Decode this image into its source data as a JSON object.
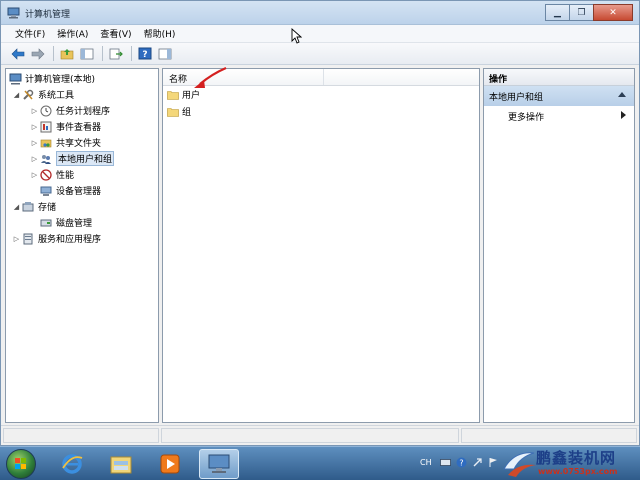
{
  "window": {
    "title": "计算机管理"
  },
  "menu": [
    "文件(F)",
    "操作(A)",
    "查看(V)",
    "帮助(H)"
  ],
  "tree": {
    "root": "计算机管理(本地)",
    "system_tools": "系统工具",
    "task_scheduler": "任务计划程序",
    "event_viewer": "事件查看器",
    "shared_folders": "共享文件夹",
    "local_users": "本地用户和组",
    "performance": "性能",
    "device_manager": "设备管理器",
    "storage": "存储",
    "disk_management": "磁盘管理",
    "services_apps": "服务和应用程序"
  },
  "list": {
    "column_name": "名称",
    "items": [
      "用户",
      "组"
    ]
  },
  "actions": {
    "header": "操作",
    "group": "本地用户和组",
    "more": "更多操作"
  },
  "taskbar": {
    "tray_lang": "CH"
  },
  "watermark": {
    "title": "鹏鑫装机网",
    "url": "www.0753px.com"
  },
  "colors": {
    "accent": "#2c6cb8",
    "selection": "#dbe7f5",
    "arrow": "#d42020"
  }
}
